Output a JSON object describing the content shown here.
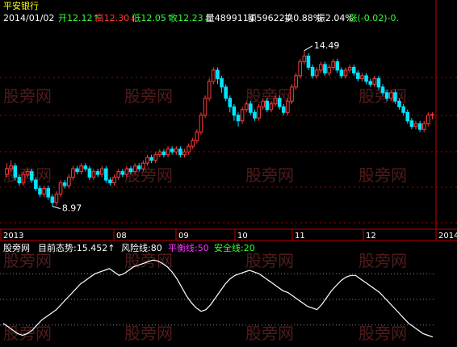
{
  "colors": {
    "background": "#000000",
    "up": "#ff3b3b",
    "down": "#00e5ff",
    "axis": "#c00000",
    "white": "#ffffff",
    "yellow": "#ffff00",
    "magenta": "#ff33ff",
    "green": "#33ff33",
    "grid": "#aa0000",
    "watermark": "#5a1f1f"
  },
  "header": {
    "stock_name": "平安银行",
    "date": "2014/01/02",
    "fields": [
      {
        "text": "开12.12↑",
        "color": "green"
      },
      {
        "text": "高12.30↓",
        "color": "up"
      },
      {
        "text": "低12.05↑",
        "color": "green"
      },
      {
        "text": "收12.23↓",
        "color": "green"
      },
      {
        "text": "量489911↓",
        "color": "white"
      },
      {
        "text": "额59622↓",
        "color": "white"
      },
      {
        "text": "换0.88%",
        "color": "white"
      },
      {
        "text": "振2.04%",
        "color": "white"
      },
      {
        "text": "涨(-0.02)-0.",
        "color": "green"
      }
    ]
  },
  "indicator_header": {
    "name": "股旁网",
    "trend_label": "目前态势:15.452↑",
    "risk_label": "风险线:80",
    "balance_label": "平衡线:50",
    "safe_label": "安全线:20"
  },
  "watermark": "股旁网",
  "chart_data": {
    "type": "candlestick",
    "x_axis_labels": [
      "2013",
      "08",
      "09",
      "10",
      "11",
      "12",
      "2014"
    ],
    "annotations": [
      {
        "label": "14.49",
        "type": "max"
      },
      {
        "label": "8.97",
        "type": "min"
      }
    ],
    "price_range": [
      8.5,
      15.2
    ],
    "candles": [
      [
        10.1,
        10.3,
        10.5,
        10.0
      ],
      [
        10.3,
        10.4,
        10.6,
        10.2
      ],
      [
        10.4,
        10.0,
        10.5,
        9.9
      ],
      [
        10.0,
        9.8,
        10.1,
        9.7
      ],
      [
        9.8,
        10.1,
        10.2,
        9.7
      ],
      [
        10.1,
        10.2,
        10.3,
        10.0
      ],
      [
        10.2,
        9.9,
        10.3,
        9.8
      ],
      [
        9.9,
        9.6,
        10.0,
        9.5
      ],
      [
        9.6,
        9.4,
        9.7,
        9.3
      ],
      [
        9.4,
        9.6,
        9.7,
        9.3
      ],
      [
        9.6,
        9.3,
        9.7,
        9.2
      ],
      [
        9.3,
        9.1,
        9.4,
        8.97
      ],
      [
        9.1,
        9.4,
        9.5,
        9.0
      ],
      [
        9.4,
        9.8,
        9.9,
        9.3
      ],
      [
        9.8,
        9.7,
        9.9,
        9.6
      ],
      [
        9.7,
        10.0,
        10.1,
        9.6
      ],
      [
        10.0,
        10.3,
        10.4,
        9.9
      ],
      [
        10.3,
        10.2,
        10.4,
        10.1
      ],
      [
        10.2,
        10.4,
        10.5,
        10.1
      ],
      [
        10.4,
        10.3,
        10.5,
        10.2
      ],
      [
        10.3,
        10.0,
        10.4,
        9.9
      ],
      [
        10.0,
        10.2,
        10.3,
        9.9
      ],
      [
        10.2,
        10.1,
        10.3,
        10.0
      ],
      [
        10.1,
        10.3,
        10.4,
        10.0
      ],
      [
        10.3,
        9.9,
        10.4,
        9.8
      ],
      [
        9.9,
        9.8,
        10.0,
        9.7
      ],
      [
        9.8,
        10.0,
        10.1,
        9.7
      ],
      [
        10.0,
        10.2,
        10.3,
        9.9
      ],
      [
        10.2,
        10.1,
        10.3,
        10.0
      ],
      [
        10.1,
        10.3,
        10.4,
        10.0
      ],
      [
        10.3,
        10.2,
        10.4,
        10.1
      ],
      [
        10.2,
        10.4,
        10.5,
        10.1
      ],
      [
        10.4,
        10.3,
        10.5,
        10.2
      ],
      [
        10.3,
        10.5,
        10.6,
        10.2
      ],
      [
        10.5,
        10.7,
        10.8,
        10.4
      ],
      [
        10.7,
        10.6,
        10.8,
        10.5
      ],
      [
        10.6,
        10.8,
        10.9,
        10.5
      ],
      [
        10.8,
        10.9,
        11.0,
        10.7
      ],
      [
        10.9,
        10.8,
        11.0,
        10.7
      ],
      [
        10.8,
        11.0,
        11.1,
        10.7
      ],
      [
        11.0,
        10.9,
        11.1,
        10.8
      ],
      [
        10.9,
        11.0,
        11.1,
        10.8
      ],
      [
        11.0,
        10.8,
        11.1,
        10.7
      ],
      [
        10.8,
        10.9,
        11.0,
        10.7
      ],
      [
        10.9,
        11.1,
        11.2,
        10.8
      ],
      [
        11.1,
        11.3,
        11.4,
        11.0
      ],
      [
        11.3,
        11.6,
        11.7,
        11.2
      ],
      [
        11.6,
        12.2,
        12.3,
        11.5
      ],
      [
        12.2,
        12.8,
        12.9,
        12.1
      ],
      [
        12.8,
        13.4,
        13.5,
        12.7
      ],
      [
        13.4,
        13.8,
        13.9,
        13.3
      ],
      [
        13.8,
        13.5,
        13.9,
        13.3
      ],
      [
        13.5,
        13.2,
        13.6,
        13.0
      ],
      [
        13.2,
        12.8,
        13.3,
        12.7
      ],
      [
        12.8,
        12.5,
        12.9,
        12.3
      ],
      [
        12.5,
        12.2,
        12.6,
        12.0
      ],
      [
        12.2,
        12.0,
        12.3,
        11.8
      ],
      [
        12.0,
        12.4,
        12.5,
        11.9
      ],
      [
        12.4,
        12.6,
        12.7,
        12.3
      ],
      [
        12.6,
        12.3,
        12.7,
        12.2
      ],
      [
        12.3,
        12.1,
        12.4,
        12.0
      ],
      [
        12.1,
        12.5,
        12.6,
        12.0
      ],
      [
        12.5,
        12.7,
        12.8,
        12.4
      ],
      [
        12.7,
        12.4,
        12.8,
        12.3
      ],
      [
        12.4,
        12.6,
        12.7,
        12.3
      ],
      [
        12.6,
        12.8,
        12.9,
        12.5
      ],
      [
        12.8,
        12.5,
        12.9,
        12.4
      ],
      [
        12.5,
        12.3,
        12.6,
        12.2
      ],
      [
        12.3,
        12.7,
        12.8,
        12.2
      ],
      [
        12.7,
        13.2,
        13.3,
        12.6
      ],
      [
        13.2,
        13.6,
        13.7,
        13.1
      ],
      [
        13.6,
        14.1,
        14.2,
        13.5
      ],
      [
        14.1,
        14.3,
        14.49,
        14.0
      ],
      [
        14.3,
        13.9,
        14.4,
        13.8
      ],
      [
        13.9,
        13.6,
        14.0,
        13.5
      ],
      [
        13.6,
        13.8,
        13.9,
        13.5
      ],
      [
        13.8,
        14.0,
        14.1,
        13.7
      ],
      [
        14.0,
        13.7,
        14.1,
        13.6
      ],
      [
        13.7,
        13.9,
        14.0,
        13.6
      ],
      [
        13.9,
        14.1,
        14.2,
        13.8
      ],
      [
        14.1,
        13.8,
        14.2,
        13.7
      ],
      [
        13.8,
        13.6,
        13.9,
        13.5
      ],
      [
        13.6,
        13.8,
        13.9,
        13.5
      ],
      [
        13.8,
        13.9,
        14.0,
        13.7
      ],
      [
        13.9,
        13.7,
        14.0,
        13.6
      ],
      [
        13.7,
        13.5,
        13.8,
        13.4
      ],
      [
        13.5,
        13.6,
        13.7,
        13.4
      ],
      [
        13.6,
        13.4,
        13.7,
        13.3
      ],
      [
        13.4,
        13.3,
        13.5,
        13.2
      ],
      [
        13.3,
        13.5,
        13.6,
        13.2
      ],
      [
        13.5,
        13.2,
        13.6,
        13.1
      ],
      [
        13.2,
        13.0,
        13.3,
        12.9
      ],
      [
        13.0,
        12.8,
        13.1,
        12.7
      ],
      [
        12.8,
        13.0,
        13.1,
        12.7
      ],
      [
        13.0,
        12.7,
        13.1,
        12.6
      ],
      [
        12.7,
        12.5,
        12.8,
        12.4
      ],
      [
        12.5,
        12.3,
        12.6,
        12.2
      ],
      [
        12.3,
        12.0,
        12.4,
        11.9
      ],
      [
        12.0,
        11.8,
        12.1,
        11.7
      ],
      [
        11.8,
        11.9,
        12.0,
        11.7
      ],
      [
        11.9,
        11.7,
        12.0,
        11.6
      ],
      [
        11.7,
        11.9,
        12.0,
        11.6
      ],
      [
        11.9,
        12.2,
        12.3,
        11.8
      ],
      [
        12.2,
        12.23,
        12.3,
        12.05
      ]
    ],
    "indicator": {
      "name": "目前态势",
      "range": [
        0,
        100
      ],
      "levels": [
        80,
        50,
        20
      ],
      "values": [
        22,
        18,
        14,
        10,
        8,
        10,
        14,
        20,
        26,
        30,
        34,
        38,
        44,
        50,
        56,
        62,
        68,
        72,
        76,
        80,
        82,
        84,
        86,
        82,
        78,
        80,
        84,
        88,
        90,
        92,
        94,
        96,
        95,
        92,
        88,
        82,
        74,
        64,
        54,
        46,
        40,
        36,
        38,
        44,
        52,
        60,
        68,
        74,
        78,
        80,
        82,
        84,
        82,
        80,
        76,
        72,
        68,
        64,
        60,
        58,
        54,
        50,
        46,
        42,
        40,
        38,
        44,
        52,
        60,
        66,
        72,
        76,
        78,
        78,
        74,
        70,
        66,
        62,
        58,
        52,
        46,
        40,
        34,
        28,
        22,
        18,
        14,
        10,
        8,
        6
      ]
    }
  }
}
